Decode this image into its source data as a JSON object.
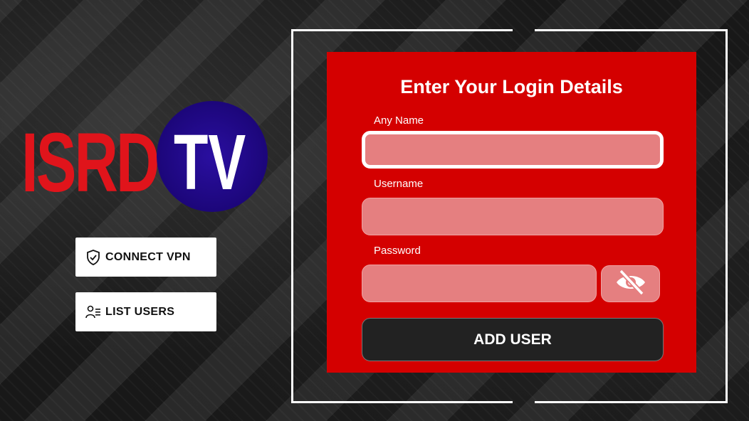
{
  "logo": {
    "part1": "ISRD",
    "part2": "TV"
  },
  "side_buttons": {
    "vpn": {
      "label": "CONNECT VPN",
      "icon": "shield-check-icon"
    },
    "users": {
      "label": "LIST USERS",
      "icon": "users-list-icon"
    }
  },
  "form": {
    "title": "Enter Your Login Details",
    "name": {
      "label": "Any Name",
      "value": ""
    },
    "username": {
      "label": "Username",
      "value": ""
    },
    "password": {
      "label": "Password",
      "value": ""
    },
    "toggle_icon": "eye-off-icon",
    "submit_label": "ADD USER"
  },
  "colors": {
    "panel": "#d40000",
    "field": "#e57f80",
    "logo_red": "#e0141b",
    "logo_circle": "#1c067a",
    "button_dark": "#222222"
  }
}
